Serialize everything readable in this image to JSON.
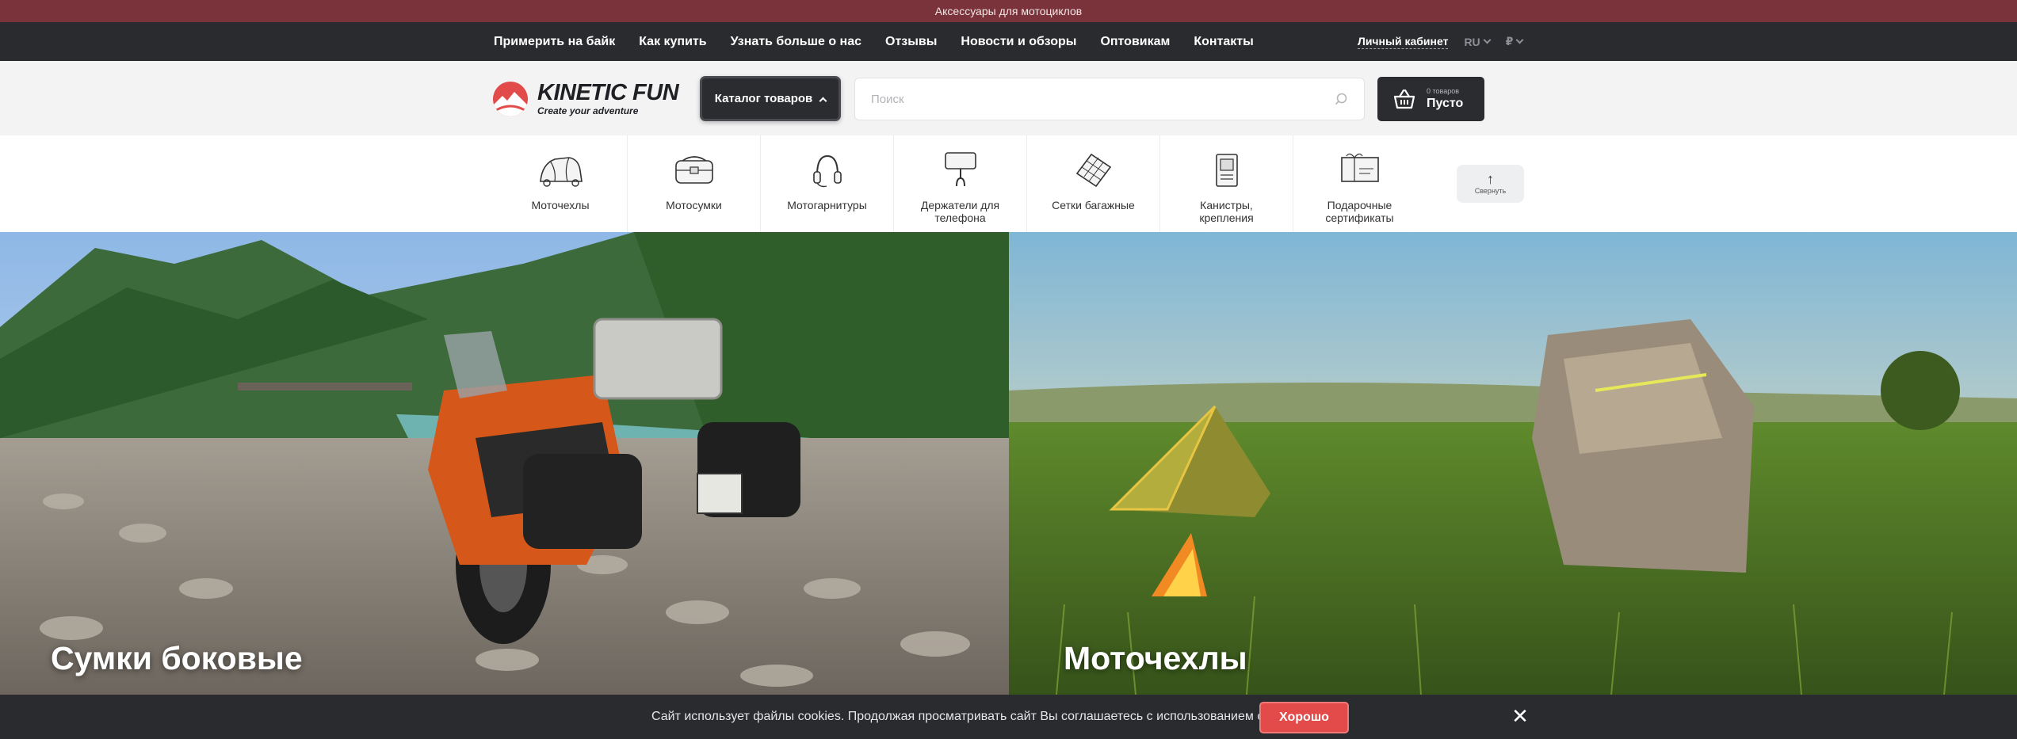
{
  "top_strip": {
    "text": "Аксессуары для мотоциклов"
  },
  "nav": {
    "links": [
      "Примерить на байк",
      "Как купить",
      "Узнать больше о нас",
      "Отзывы",
      "Новости и обзоры",
      "Оптовикам",
      "Контакты"
    ],
    "account": "Личный кабинет",
    "language": "RU",
    "currency": "₽"
  },
  "header": {
    "logo": {
      "brand": "KINETIC FUN",
      "tagline": "Create your adventure"
    },
    "catalog_label": "Каталог товаров",
    "search_placeholder": "Поиск",
    "cart": {
      "count": "0 товаров",
      "status": "Пусто"
    }
  },
  "categories": {
    "items": [
      {
        "label": "Моточехлы",
        "icon": "moto-cover-icon"
      },
      {
        "label": "Мотосумки",
        "icon": "moto-bag-icon"
      },
      {
        "label": "Мотогарнитуры",
        "icon": "headset-icon"
      },
      {
        "label": "Держатели для телефона",
        "icon": "phone-holder-icon"
      },
      {
        "label": "Сетки багажные",
        "icon": "cargo-net-icon"
      },
      {
        "label": "Канистры, крепления",
        "icon": "canister-icon"
      },
      {
        "label": "Подарочные сертификаты",
        "icon": "gift-certificate-icon"
      }
    ],
    "collapse_label": "Свернуть"
  },
  "hero": {
    "left_title": "Сумки боковые",
    "right_title": "Моточехлы"
  },
  "cookie": {
    "message": "Сайт использует файлы cookies. Продолжая просматривать сайт Вы соглашаетесь с использованием cookies.",
    "ok_label": "Хорошо"
  },
  "colors": {
    "top_strip": "#7a333a",
    "nav_bg": "#2a2b2f",
    "accent": "#e24b49",
    "header_bg": "#f3f3f4"
  }
}
